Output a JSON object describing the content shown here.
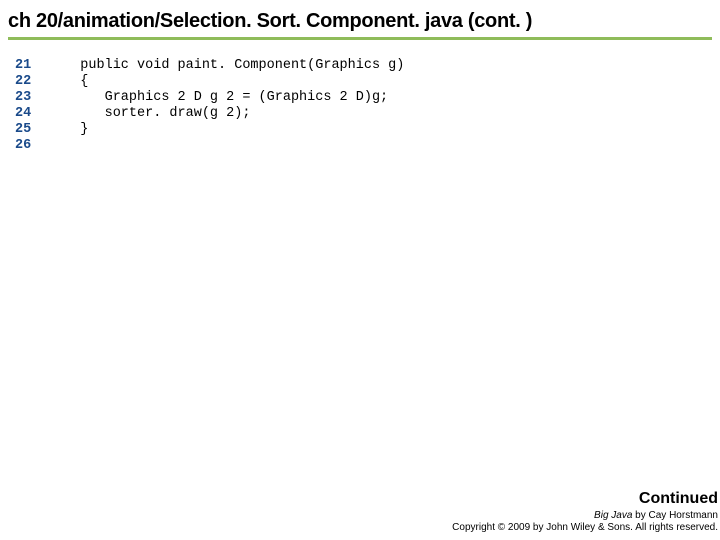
{
  "title": "ch 20/animation/Selection. Sort. Component. java (cont. )",
  "code": {
    "lines": [
      {
        "n": "21",
        "t": "   public void paint. Component(Graphics g)"
      },
      {
        "n": "22",
        "t": "   {"
      },
      {
        "n": "23",
        "t": "      Graphics 2 D g 2 = (Graphics 2 D)g;"
      },
      {
        "n": "24",
        "t": "      sorter. draw(g 2);"
      },
      {
        "n": "25",
        "t": "   }"
      },
      {
        "n": "26",
        "t": ""
      }
    ]
  },
  "footer": {
    "continued": "Continued",
    "book": "Big Java",
    "author": " by Cay Horstmann",
    "copyright": "Copyright © 2009 by John Wiley & Sons.  All rights reserved."
  }
}
